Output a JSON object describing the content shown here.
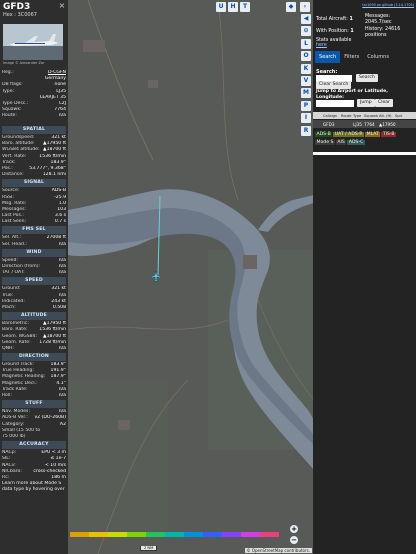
{
  "aircraft": {
    "callsign": "GFD3",
    "hex_line": "Hex : 3C0067",
    "photo_credit": "Image © Alexander Zor"
  },
  "details": [
    {
      "k": "Reg.:",
      "v": "D-CGFN"
    },
    {
      "k": "",
      "v": "Germany"
    },
    {
      "k": "DB flags:",
      "v": "none"
    },
    {
      "k": "Type:",
      "v": "LJ35"
    },
    {
      "k": "",
      "v": "LEARJET 35"
    },
    {
      "k": "Type Desc.:",
      "v": "L2J"
    },
    {
      "k": "Squawk:",
      "v": "7764"
    },
    {
      "k": "Route:",
      "v": "n/a"
    }
  ],
  "sections": {
    "spatial": {
      "title": "SPATIAL",
      "rows": [
        {
          "k": "Groundspeed:",
          "v": "321 kt"
        },
        {
          "k": "Baro. altitude:",
          "v": "▲17950 ft"
        },
        {
          "k": "WGS84 altitude:",
          "v": "▲18700 ft"
        },
        {
          "k": "Vert. Rate:",
          "v": "1536 ft/min"
        },
        {
          "k": "Track:",
          "v": "183.9°"
        },
        {
          "k": "Pos.:",
          "v": "53.777°, 9.368°"
        },
        {
          "k": "Distance:",
          "v": "128.1 nmi"
        }
      ]
    },
    "signal": {
      "title": "SIGNAL",
      "rows": [
        {
          "k": "Source:",
          "v": "ADS-B"
        },
        {
          "k": "RSSI:",
          "v": "-25.9"
        },
        {
          "k": "Msg. Rate:",
          "v": "1.0"
        },
        {
          "k": "Messages:",
          "v": "103"
        },
        {
          "k": "Last Pos.:",
          "v": "3.6 s"
        },
        {
          "k": "Last Seen:",
          "v": "0.7 s"
        }
      ]
    },
    "fms": {
      "title": "FMS SEL",
      "rows": [
        {
          "k": "Sel. Alt.:",
          "v": "27008 ft"
        },
        {
          "k": "Sel. Head.:",
          "v": "n/a"
        }
      ]
    },
    "wind": {
      "title": "WIND",
      "rows": [
        {
          "k": "Speed:",
          "v": "n/a"
        },
        {
          "k": "Direction (from):",
          "v": "n/a"
        },
        {
          "k": "TAT / OAT:",
          "v": "n/a"
        }
      ]
    },
    "speed": {
      "title": "SPEED",
      "rows": [
        {
          "k": "Ground:",
          "v": "321 kt"
        },
        {
          "k": "True:",
          "v": "n/a"
        },
        {
          "k": "Indicated:",
          "v": "243 kt"
        },
        {
          "k": "Mach:",
          "v": "0.508"
        }
      ]
    },
    "altitude": {
      "title": "ALTITUDE",
      "rows": [
        {
          "k": "Barometric:",
          "v": "▲17950 ft"
        },
        {
          "k": "Baro. Rate:",
          "v": "1536 ft/min"
        },
        {
          "k": "Geom. WGS84:",
          "v": "▲18700 ft"
        },
        {
          "k": "Geom. Rate:",
          "v": "1728 ft/min"
        },
        {
          "k": "QNH:",
          "v": "n/a"
        }
      ]
    },
    "direction": {
      "title": "DIRECTION",
      "rows": [
        {
          "k": "Ground Track:",
          "v": "183.9°"
        },
        {
          "k": "True Heading:",
          "v": "191.9°"
        },
        {
          "k": "Magnetic Heading:",
          "v": "187.9°"
        },
        {
          "k": "Magnetic Decl.:",
          "v": "4.1°"
        },
        {
          "k": "Track Rate:",
          "v": "n/a"
        },
        {
          "k": "Roll:",
          "v": "n/a"
        }
      ]
    },
    "stuff": {
      "title": "STUFF",
      "rows": [
        {
          "k": "Nav. Modes:",
          "v": "n/a"
        },
        {
          "k": "ADS-B Ver.:",
          "v": "v2 (DO-260B)"
        },
        {
          "k": "Category:",
          "v": "A2"
        },
        {
          "k": "Small (15 500 to",
          "v": ""
        },
        {
          "k": "75 000 lb)",
          "v": ""
        }
      ]
    },
    "accuracy": {
      "title": "ACCURACY",
      "rows": [
        {
          "k": "NACp:",
          "v": "EPU < 3 m"
        },
        {
          "k": "SIL:",
          "v": "≤ 1e-7"
        },
        {
          "k": "NACv:",
          "v": "< 10 m/s"
        },
        {
          "k": "NICbaro:",
          "v": "cross-checked"
        },
        {
          "k": "Rc:",
          "v": "186 m"
        }
      ]
    }
  },
  "footer_text": "Learn more about Mode S data type by hovering over",
  "map_top_buttons": [
    "U",
    "H",
    "T"
  ],
  "side_buttons": [
    "◀",
    "⊙",
    "L",
    "O",
    "K",
    "V",
    "M",
    "P",
    "I",
    "R"
  ],
  "right": {
    "github": "tar1090 on github (3.14.1705)",
    "total_label": "Total Aircraft:",
    "total_value": "1",
    "with_pos_label": "With Position:",
    "with_pos_value": "1",
    "stats_label": "Stats available",
    "stats_link": "here",
    "messages_label": "Messages:",
    "messages_value": "2045.7/sec",
    "history_label": "History:",
    "history_value": "24616 positions",
    "tabs": [
      "Search",
      "Filters",
      "Columns"
    ],
    "search_label": "Search:",
    "search_button": "Search",
    "clear_search": "Clear Search",
    "jump_label": "Jump to Airport or Latitude, Longitude:",
    "jump_button": "Jump",
    "clear_button": "Clear",
    "columns": [
      "Callsign",
      "Route",
      "Type",
      "Squawk",
      "Alt. (ft)",
      "Spd."
    ],
    "row": [
      "GFD3",
      "",
      "LJ35",
      "7764",
      "▲17950",
      ""
    ],
    "legend": [
      "ADS-B",
      "UAT / ADS-R",
      "MLAT",
      "TIS-B",
      "Mode S",
      "AIS",
      "ADS-C"
    ]
  },
  "colors": {
    "adsb": "#1e4a1e",
    "uat": "#6f6f1f",
    "mlat": "#8a6a16",
    "tisb": "#8b2b2b",
    "ais": "#3a3a3a",
    "adsc": "#2f5c5c",
    "accent": "#0a58a8"
  },
  "map": {
    "zoom_in": "+",
    "zoom_out": "−",
    "scale": "2 NM",
    "attribution": "© OpenStreetMap contributors."
  }
}
